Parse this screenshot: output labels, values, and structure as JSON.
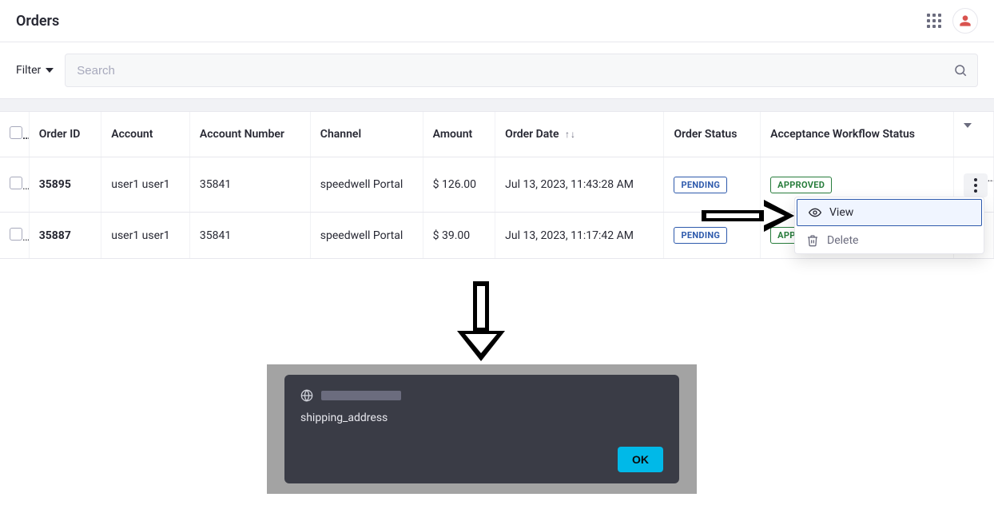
{
  "header": {
    "title": "Orders"
  },
  "toolbar": {
    "filter_label": "Filter",
    "search_placeholder": "Search"
  },
  "table": {
    "columns": {
      "order_id": "Order ID",
      "account": "Account",
      "account_number": "Account Number",
      "channel": "Channel",
      "amount": "Amount",
      "order_date": "Order Date",
      "order_status": "Order Status",
      "acceptance_status": "Acceptance Workflow Status"
    },
    "rows": [
      {
        "order_id": "35895",
        "account": "user1 user1",
        "account_number": "35841",
        "channel": "speedwell Portal",
        "amount": "$ 126.00",
        "order_date": "Jul 13, 2023, 11:43:28 AM",
        "order_status": "PENDING",
        "acceptance_status": "APPROVED"
      },
      {
        "order_id": "35887",
        "account": "user1 user1",
        "account_number": "35841",
        "channel": "speedwell Portal",
        "amount": "$ 39.00",
        "order_date": "Jul 13, 2023, 11:17:42 AM",
        "order_status": "PENDING",
        "acceptance_status": "APPROVED"
      }
    ]
  },
  "row_menu": {
    "view": "View",
    "delete": "Delete"
  },
  "dialog": {
    "message": "shipping_address",
    "ok": "OK"
  },
  "colors": {
    "pending": "#2e5aac",
    "approved": "#287d3c",
    "accent": "#00b9e8"
  }
}
